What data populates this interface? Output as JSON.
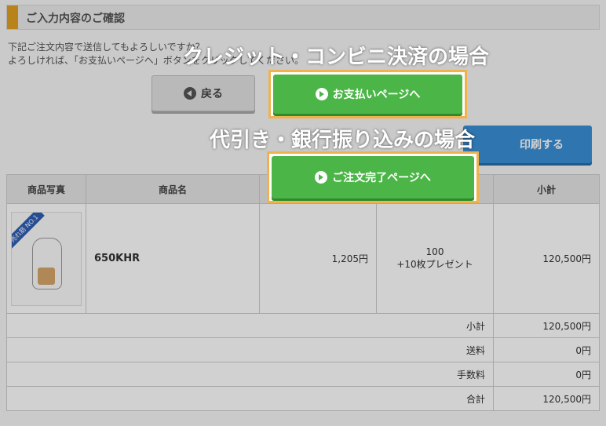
{
  "header": {
    "title": "ご入力内容のご確認"
  },
  "intro": {
    "line1": "下記ご注文内容で送信してもよろしいですか？",
    "line2": "よろしければ、「お支払いページへ」ボタンをクリックしてください。"
  },
  "buttons": {
    "back": "戻る",
    "pay": "お支払いページへ",
    "complete": "ご注文完了ページへ",
    "print": "印刷する"
  },
  "captions": {
    "credit": "クレジット・コンビニ決済の場合",
    "cod": "代引き・銀行振り込みの場合"
  },
  "table": {
    "headers": [
      "商品写真",
      "商品名",
      "",
      "",
      "小計"
    ],
    "item": {
      "badge": "売れ筋 NO.1",
      "name": "650KHR",
      "price": "1,205円",
      "qty": "100",
      "bonus": "+10枚プレゼント",
      "subtotal": "120,500円"
    },
    "summary": [
      {
        "label": "小計",
        "value": "120,500円"
      },
      {
        "label": "送料",
        "value": "0円"
      },
      {
        "label": "手数料",
        "value": "0円"
      },
      {
        "label": "合計",
        "value": "120,500円"
      }
    ]
  },
  "colors": {
    "accent": "#e0a020",
    "green": "#4cb548",
    "blue": "#3a8fd6",
    "highlight": "#f0b24a"
  }
}
